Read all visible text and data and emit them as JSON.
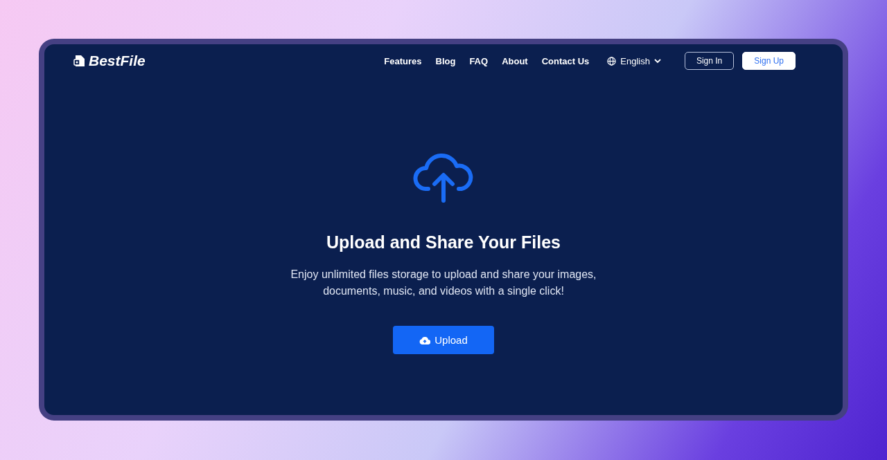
{
  "logo": {
    "text": "BestFile"
  },
  "nav": {
    "links": [
      "Features",
      "Blog",
      "FAQ",
      "About",
      "Contact Us"
    ],
    "language": "English",
    "buttons": [
      {
        "label": "Sign In",
        "kind": "outline"
      },
      {
        "label": "Sign Up",
        "kind": "solid"
      }
    ]
  },
  "hero": {
    "title": "Upload and Share Your Files",
    "description": "Enjoy unlimited files storage to upload and share your images, documents, music, and videos with a single click!",
    "button": "Upload"
  }
}
